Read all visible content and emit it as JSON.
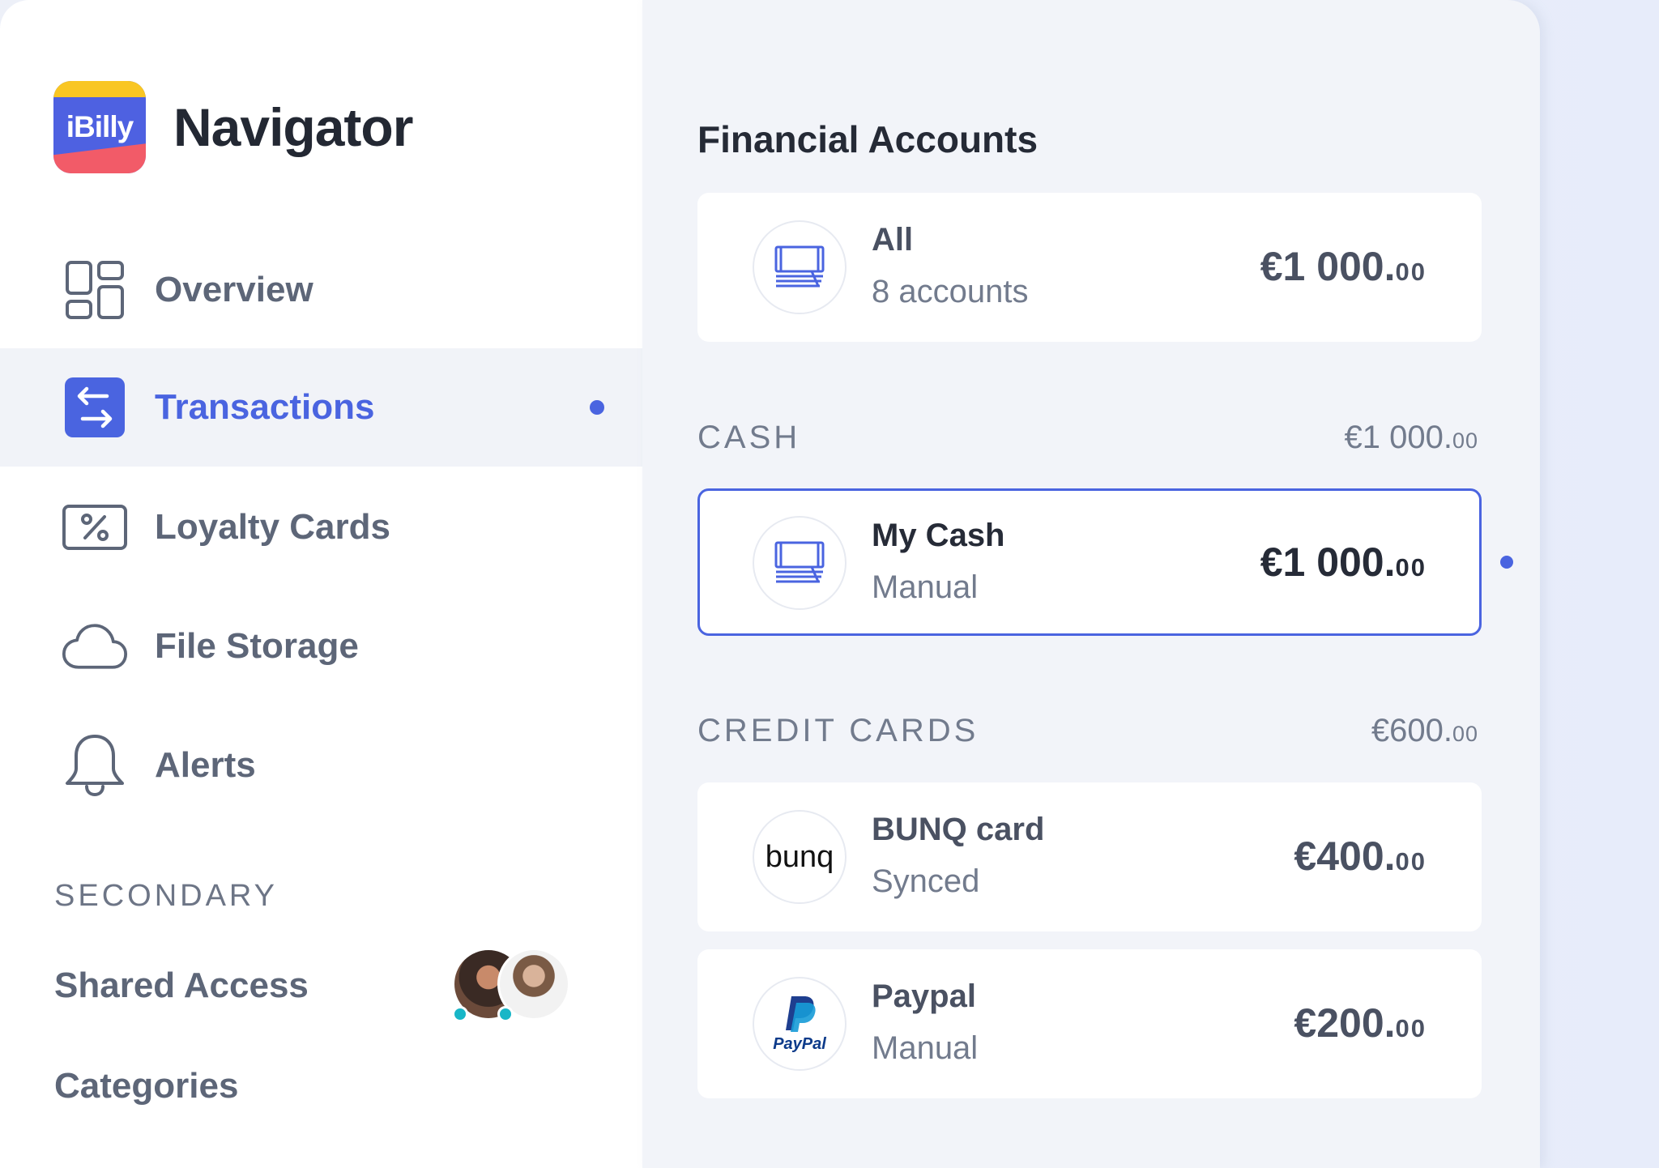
{
  "app": {
    "logo_text": "iBilly",
    "name": "Navigator"
  },
  "sidebar": {
    "items": [
      {
        "label": "Overview",
        "icon": "overview-icon",
        "active": false
      },
      {
        "label": "Transactions",
        "icon": "transactions-icon",
        "active": true
      },
      {
        "label": "Loyalty Cards",
        "icon": "loyalty-card-icon",
        "active": false
      },
      {
        "label": "File Storage",
        "icon": "cloud-icon",
        "active": false
      },
      {
        "label": "Alerts",
        "icon": "bell-icon",
        "active": false
      }
    ],
    "secondary_heading": "SECONDARY",
    "secondary_items": [
      {
        "label": "Shared Access"
      },
      {
        "label": "Categories"
      }
    ]
  },
  "main": {
    "title": "Financial Accounts",
    "all": {
      "name": "All",
      "sub": "8 accounts",
      "amount_main": "€1 000.",
      "amount_cents": "00",
      "icon": "cash-stack-icon"
    },
    "groups": [
      {
        "heading": "CASH",
        "total_main": "€1 000.",
        "total_cents": "00",
        "accounts": [
          {
            "name": "My Cash",
            "sub": "Manual",
            "amount_main": "€1 000.",
            "amount_cents": "00",
            "icon": "cash-stack-icon",
            "selected": true
          }
        ]
      },
      {
        "heading": "CREDIT CARDS",
        "total_main": "€600.",
        "total_cents": "00",
        "accounts": [
          {
            "name": "BUNQ card",
            "sub": "Synced",
            "amount_main": "€400.",
            "amount_cents": "00",
            "icon": "bunq-logo",
            "logo_text": "bunq",
            "selected": false
          },
          {
            "name": "Paypal",
            "sub": "Manual",
            "amount_main": "€200.",
            "amount_cents": "00",
            "icon": "paypal-logo",
            "logo_text": "PayPal",
            "selected": false
          }
        ]
      }
    ]
  },
  "colors": {
    "accent": "#4a64e0",
    "text_dark": "#252a36",
    "text_muted": "#727b8d",
    "online": "#18b6c7"
  }
}
